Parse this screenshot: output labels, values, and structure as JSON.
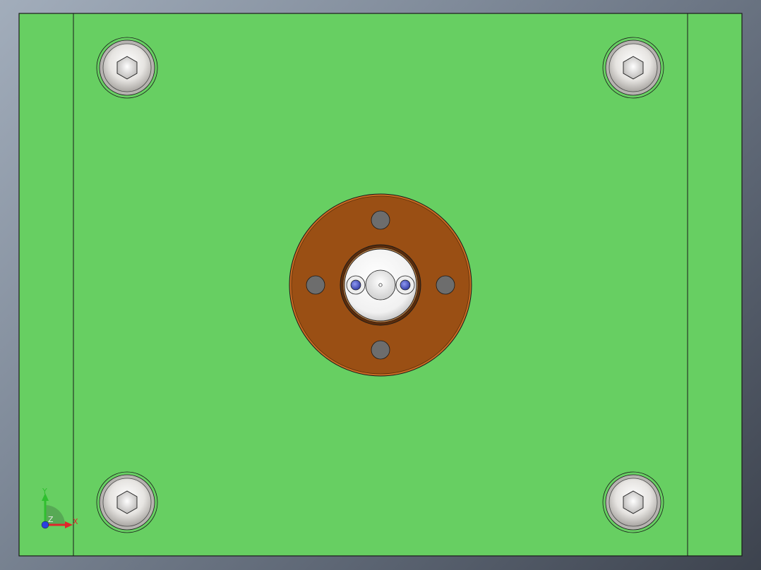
{
  "viewport": {
    "background": "gradient-gray",
    "part_color": "#67cf62",
    "edge_color": "#1a1a1a"
  },
  "parts": {
    "base_plate": {
      "name": "green plate",
      "color": "#67cf62"
    },
    "locating_ring": {
      "color": "#9a4f14",
      "rim_color": "#c76a22",
      "hole_color": "#6d6d6d",
      "hole_count": 4
    },
    "sprue_bushing": {
      "color": "#f2f2f2",
      "pin_color": "#5a66c8"
    },
    "socket_head_screws": {
      "count": 4,
      "color": "#e2dfdc"
    }
  },
  "triad": {
    "x_label": "X",
    "y_label": "Y",
    "z_label": "Z",
    "x_color": "#e0262b",
    "y_color": "#2fbf2f",
    "z_color": "#2b3fe0"
  }
}
